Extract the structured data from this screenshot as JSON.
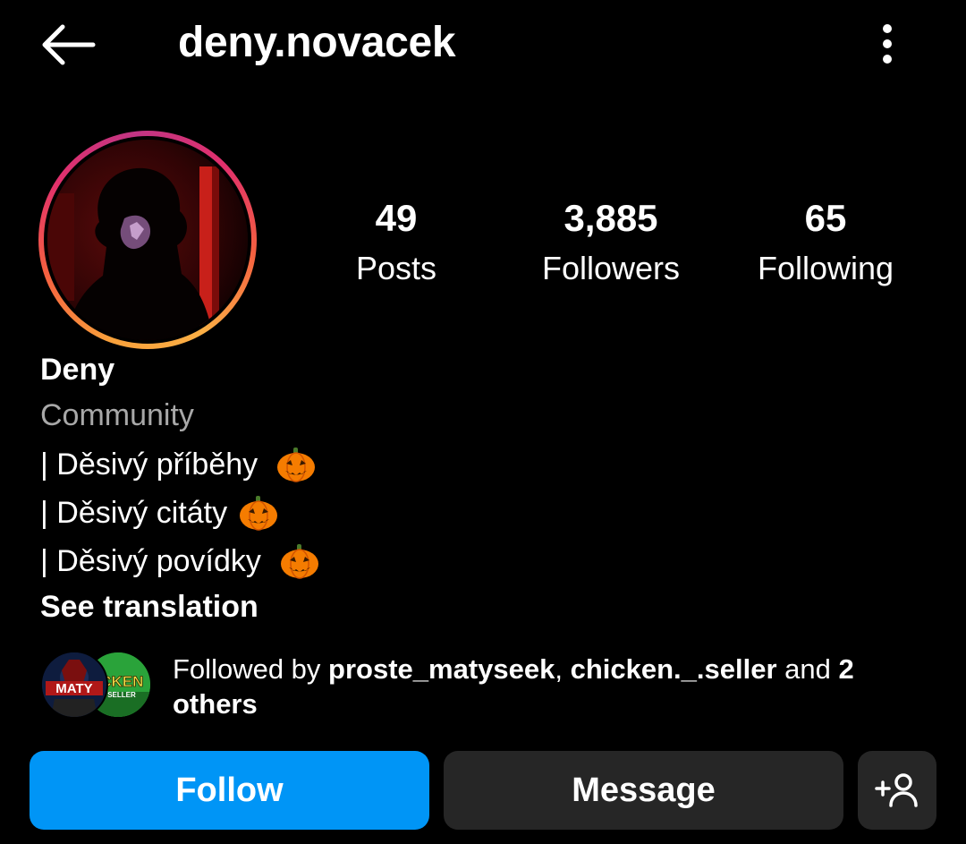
{
  "header": {
    "username": "deny.novacek"
  },
  "stats": [
    {
      "value": "49",
      "label": "Posts"
    },
    {
      "value": "3,885",
      "label": "Followers"
    },
    {
      "value": "65",
      "label": "Following"
    }
  ],
  "bio": {
    "name": "Deny",
    "category": "Community",
    "lines": [
      "| Děsivý příběhy",
      "| Děsivý citáty",
      "| Děsivý povídky"
    ],
    "line_emoji": "pumpkin-icon",
    "see_translation": "See translation"
  },
  "followed_by": {
    "prefix": "Followed by ",
    "users": [
      "proste_matyseek",
      "chicken._.seller"
    ],
    "separator": ", ",
    "and_text": " and ",
    "others_count": "2",
    "others_label": "others",
    "avatar_texts": [
      "MATY",
      "ICKEN",
      "SELLER"
    ]
  },
  "actions": {
    "follow": "Follow",
    "message": "Message",
    "add_icon": "add-person-icon"
  },
  "colors": {
    "background": "#000000",
    "follow_button": "#0095f6",
    "secondary_button": "#262626",
    "muted_text": "#a8a8a8"
  }
}
